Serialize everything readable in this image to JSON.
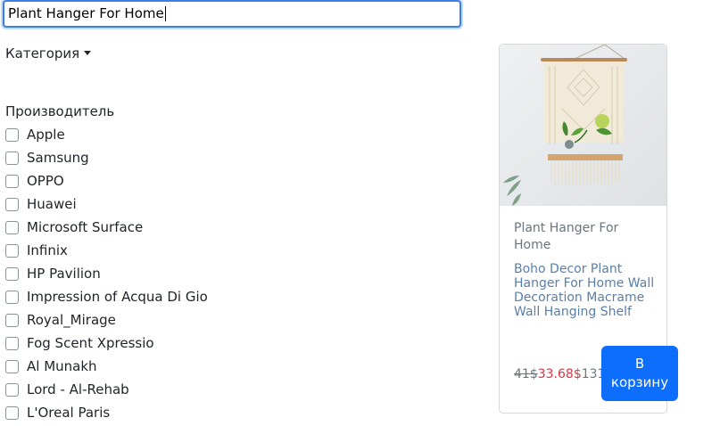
{
  "search": {
    "value": "Plant Hanger For Home"
  },
  "filters": {
    "category_label": "Категория",
    "manufacturer_label": "Производитель",
    "brands": [
      "Apple",
      "Samsung",
      "OPPO",
      "Huawei",
      "Microsoft Surface",
      "Infinix",
      "HP Pavilion",
      "Impression of Acqua Di Gio",
      "Royal_Mirage",
      "Fog Scent Xpressio",
      "Al Munakh",
      "Lord - Al-Rehab",
      "L'Oreal Paris"
    ]
  },
  "product": {
    "title": "Plant Hanger For Home",
    "description": "Boho Decor Plant Hanger For Home Wall Decoration Macrame Wall Hanging Shelf",
    "old_price": "41$",
    "new_price": "33.68$",
    "count": "131",
    "cart_label": "В корзину",
    "image_icon": "macrame-plant-hanger-image"
  },
  "colors": {
    "accent": "#0d6efd",
    "sale": "#dc3545",
    "muted": "#6c757d",
    "link_text": "#5a7fa6"
  }
}
